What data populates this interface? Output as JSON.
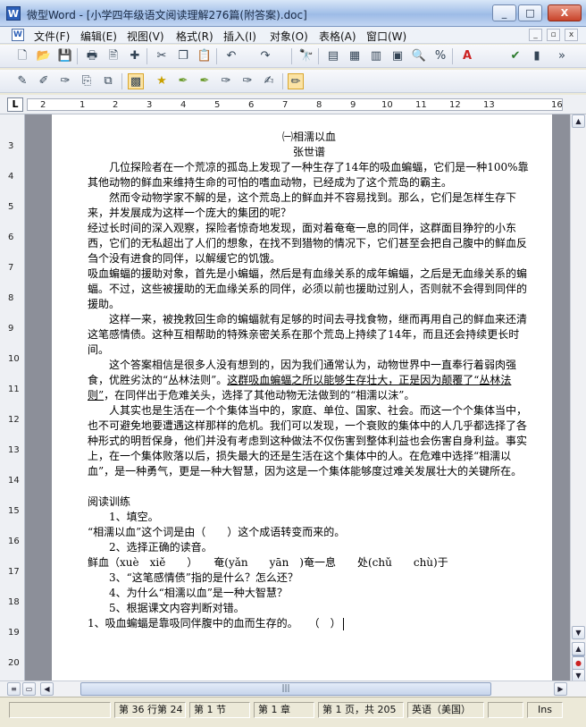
{
  "window": {
    "app_name": "微型Word",
    "title": "微型Word - [小学四年级语文阅读理解276篇(附答案).doc]",
    "controls": {
      "minimize": "_",
      "maximize": "□",
      "close": "X"
    }
  },
  "menu": {
    "items": [
      "文件(F)",
      "编辑(E)",
      "视图(V)",
      "格式(R)",
      "插入(I)",
      "对象(O)",
      "表格(A)",
      "窗口(W)"
    ],
    "mdi": [
      "_",
      "▫",
      "x"
    ]
  },
  "toolbar1": {
    "icons": [
      "new-document-icon",
      "open-folder-icon",
      "save-icon",
      "print-icon",
      "print-preview-icon",
      "export-pdf-icon",
      "cut-icon",
      "copy-icon",
      "paste-icon",
      "undo-icon",
      "redo-icon",
      "find-icon",
      "page-setup-icon",
      "table-icon",
      "columns-icon",
      "frame-icon",
      "zoom-icon",
      "percent-icon",
      "font-icon",
      "spellcheck-icon",
      "chart-icon",
      "more-icon"
    ]
  },
  "toolbar2": {
    "icons": [
      "insert-object-icon",
      "edit-note-icon",
      "delete-note-icon",
      "note-list-icon",
      "highlight-note-icon",
      "star-mark-icon",
      "pen-mark-icon",
      "pen-2-icon",
      "pen-3-icon",
      "pen-4-icon",
      "pen-5-icon",
      "comment-icon"
    ]
  },
  "ruler": {
    "tab_selector": "L",
    "numbers": [
      "2",
      "1",
      "1",
      "2",
      "3",
      "4",
      "5",
      "6",
      "7",
      "8",
      "9",
      "10",
      "11",
      "12",
      "13",
      "14",
      "16"
    ],
    "vertical_numbers": [
      "3",
      "4",
      "5",
      "6",
      "7",
      "8",
      "9",
      "10",
      "11",
      "12",
      "13",
      "14",
      "15",
      "16",
      "17",
      "18",
      "19",
      "20"
    ]
  },
  "document": {
    "heading": "㈠相濡以血",
    "author": "张世谱",
    "paragraphs": [
      "几位探险者在一个荒凉的孤岛上发现了一种生存了14年的吸血蝙蝠，它们是一种100%靠其他动物的鲜血来维持生命的可怕的嗜血动物，已经成为了这个荒岛的霸主。",
      "然而令动物学家不解的是，这个荒岛上的鲜血并不容易找到。那么，它们是怎样生存下来，并发展成为这样一个庞大的集团的呢？",
      "经过长时间的深入观察，探险者惊奇地发现，面对着奄奄一息的同伴，这群面目狰狞的小东西，它们的无私超出了人们的想象，在找不到猎物的情况下，它们甚至会把自己腹中的鲜血反刍个没有进食的同伴，以解缓它的饥饿。",
      "吸血蝙蝠的援助对象，首先是小蝙蝠，然后是有血缘关系的成年蝙蝠，之后是无血缘关系的蝙蝠。不过，这些被援助的无血缘关系的同伴，必须以前也援助过别人，否则就不会得到同伴的援助。",
      "这样一来，被挽救回生命的蝙蝠就有足够的时间去寻找食物，继而再用自己的鲜血来还清这笔感情债。这种互相帮助的特殊亲密关系在那个荒岛上持续了14年，而且还会持续更长时间。"
    ],
    "para6_before": "这个答案相信是很多人没有想到的，因为我们通常认为，动物世界中一直奉行着弱肉强食，优胜劣汰的“丛林法则”。",
    "para6_underlined": "这群吸血蝙蝠之所以能够生存壮大，正是因为颠覆了“丛林法则”",
    "para6_after": "，在同伴出于危难关头，选择了其他动物无法做到的“相濡以沫”。",
    "para7": "人其实也是生活在一个个集体当中的，家庭、单位、国家、社会。而这一个个集体当中，也不可避免地要遭遇这样那样的危机。我们可以发现，一个衰败的集体中的人几乎都选择了各种形式的明哲保身，他们并没有考虑到这种做法不仅伤害到整体利益也会伤害自身利益。事实上，在一个集体败落以后，损失最大的还是生活在这个集体中的人。在危难中选择“相濡以血”，是一种勇气，更是一种大智慧，因为这是一个集体能够度过难关发展壮大的关键所在。",
    "exercise_title": "阅读训练",
    "q1": "1、填空。",
    "q1_line": "“相濡以血”这个词是由（　　）这个成语转变而来的。",
    "q2": "2、选择正确的读音。",
    "q2_line": "鲜血（xuè　xiě　　）　　奄(yǎn　　yān　)奄一息　　处(chǔ　　chù)于",
    "q3": "3、“这笔感情债”指的是什么？怎么还？",
    "q4": "4、为什么“相濡以血”是一种大智慧？",
    "q5": "5、根据课文内容判断对错。",
    "q5_line": "1、吸血蝙蝠是靠吸同伴腹中的血而生存的。　　（　）"
  },
  "scrollbar": {
    "hthumb_grip": "|||"
  },
  "status": {
    "position": "第 36 行第 24",
    "section": "第 1 节",
    "chapter": "第 1 章",
    "page": "第 1 页，共 205",
    "language": "英语（美国）",
    "mode": "Ins"
  }
}
